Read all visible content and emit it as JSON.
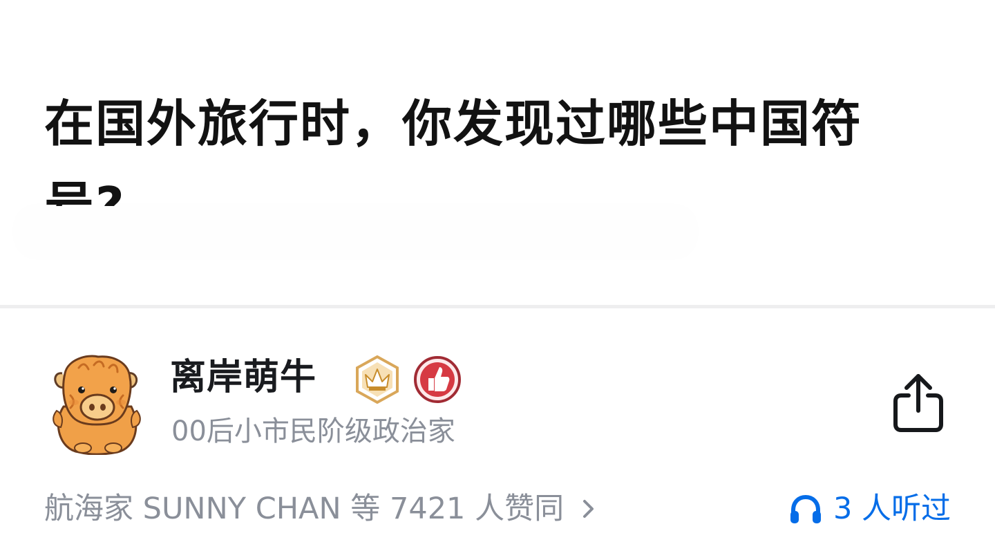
{
  "question": {
    "title": "在国外旅行时，你发现过哪些中国符号?"
  },
  "author": {
    "name": "离岸萌牛",
    "bio": "00后小市民阶级政治家",
    "avatar_icon": "yak-cartoon-avatar",
    "badges": [
      {
        "icon": "crown-badge-icon",
        "color": "#d9a75a"
      },
      {
        "icon": "thumbs-up-badge-icon",
        "color": "#c9343d"
      }
    ]
  },
  "actions": {
    "share_icon": "share-icon"
  },
  "footer": {
    "agree_text": "航海家 SUNNY CHAN 等 7421 人赞同",
    "listen_text": "3 人听过",
    "listen_color": "#056de8"
  },
  "colors": {
    "title": "#121212",
    "secondary": "#8a8f99",
    "accent": "#056de8"
  }
}
